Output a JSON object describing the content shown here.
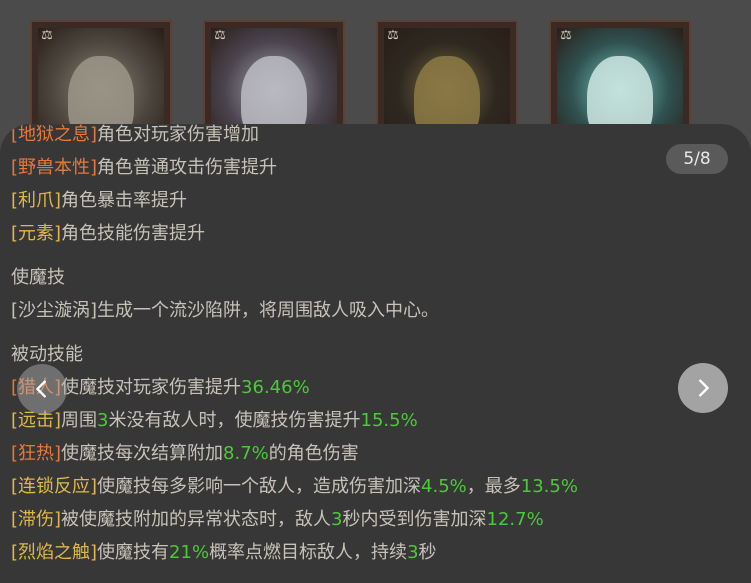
{
  "cards": [
    {
      "name": "card-1",
      "icon": "balance-scale-icon"
    },
    {
      "name": "card-2",
      "icon": "balance-scale-icon"
    },
    {
      "name": "card-3",
      "icon": "balance-scale-icon"
    },
    {
      "name": "card-4",
      "icon": "balance-scale-icon"
    }
  ],
  "pager": {
    "text": "5/8"
  },
  "lines": {
    "l0": {
      "tag": "[地狱之息]",
      "text": "角色对玩家伤害增加"
    },
    "l1": {
      "tag": "[野兽本性]",
      "text": "角色普通攻击伤害提升"
    },
    "l2": {
      "tag": "[利爪]",
      "text": "角色暴击率提升"
    },
    "l3": {
      "tag": "[元素]",
      "text": "角色技能伤害提升"
    }
  },
  "summon": {
    "title": "使魔技",
    "desc": "[沙尘漩涡]生成一个流沙陷阱，将周围敌人吸入中心。"
  },
  "passive": {
    "title": "被动技能",
    "p0": {
      "tag": "[猎人]",
      "a": "使魔技对玩家伤害提升",
      "n1": "36.46%"
    },
    "p1": {
      "tag": "[远击]",
      "a": "周围",
      "n1": "3",
      "b": "米没有敌人时，使魔技伤害提升",
      "n2": "15.5%"
    },
    "p2": {
      "tag": "[狂热]",
      "a": "使魔技每次结算附加",
      "n1": "8.7%",
      "b": "的角色伤害"
    },
    "p3": {
      "tag": "[连锁反应]",
      "a": "使魔技每多影响一个敌人，造成伤害加深",
      "n1": "4.5%",
      "b": "，最多",
      "n2": "13.5%"
    },
    "p4": {
      "tag": "[滞伤]",
      "a": "被使魔技附加的异常状态时，敌人",
      "n1": "3",
      "b": "秒内受到伤害加深",
      "n2": "12.7%"
    },
    "p5": {
      "tag": "[烈焰之触]",
      "a": "使魔技有",
      "n1": "21%",
      "b": "概率点燃目标敌人，持续",
      "n2": "3",
      "c": "秒"
    }
  },
  "colors": {
    "tag_orange": "#e8783a",
    "tag_gold": "#e0b84a",
    "number_green": "#4cc93a"
  }
}
